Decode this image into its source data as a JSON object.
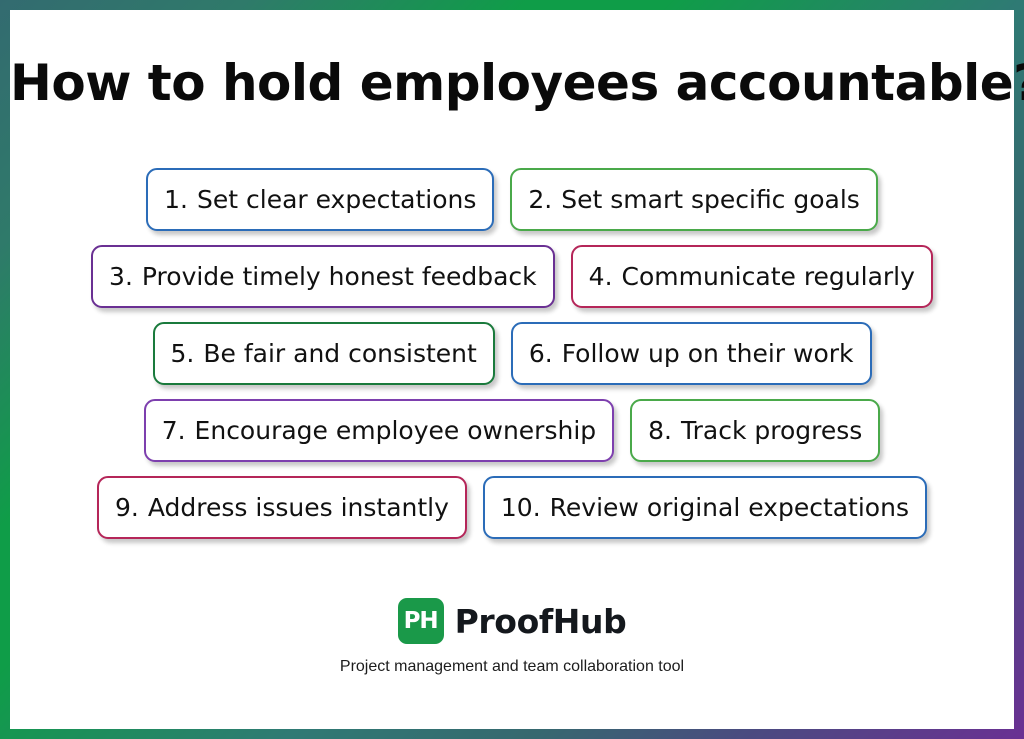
{
  "poster": {
    "title": "How to hold employees accountable?",
    "frame_colors": {
      "top_left": "#336b70",
      "top_right": "#0f9d48",
      "bottom_right": "#336b70",
      "bottom_left": "#6a3093"
    },
    "background": "#ffffff"
  },
  "rows": [
    {
      "items": [
        {
          "num": "1.",
          "text": "Set clear expectations",
          "color": "#2b6cb8"
        },
        {
          "num": "2.",
          "text": "Set smart specific goals",
          "color": "#4aa94a"
        }
      ]
    },
    {
      "items": [
        {
          "num": "3.",
          "text": "Provide timely honest feedback",
          "color": "#6a3093"
        },
        {
          "num": "4.",
          "text": "Communicate regularly",
          "color": "#b52659"
        }
      ]
    },
    {
      "items": [
        {
          "num": "5.",
          "text": "Be fair and consistent",
          "color": "#1a7a3c"
        },
        {
          "num": "6.",
          "text": "Follow up on their work",
          "color": "#2b6cb8"
        }
      ]
    },
    {
      "items": [
        {
          "num": "7.",
          "text": "Encourage employee ownership",
          "color": "#7d3fae"
        },
        {
          "num": "8.",
          "text": "Track progress",
          "color": "#4aa94a"
        }
      ]
    },
    {
      "items": [
        {
          "num": "9.",
          "text": "Address issues instantly",
          "color": "#b52659"
        },
        {
          "num": "10.",
          "text": "Review original expectations",
          "color": "#2b6cb8"
        }
      ]
    }
  ],
  "brand": {
    "logo_monogram": "PH",
    "logo_color": "#1a9949",
    "name": "ProofHub",
    "tagline": "Project management and team collaboration tool"
  }
}
